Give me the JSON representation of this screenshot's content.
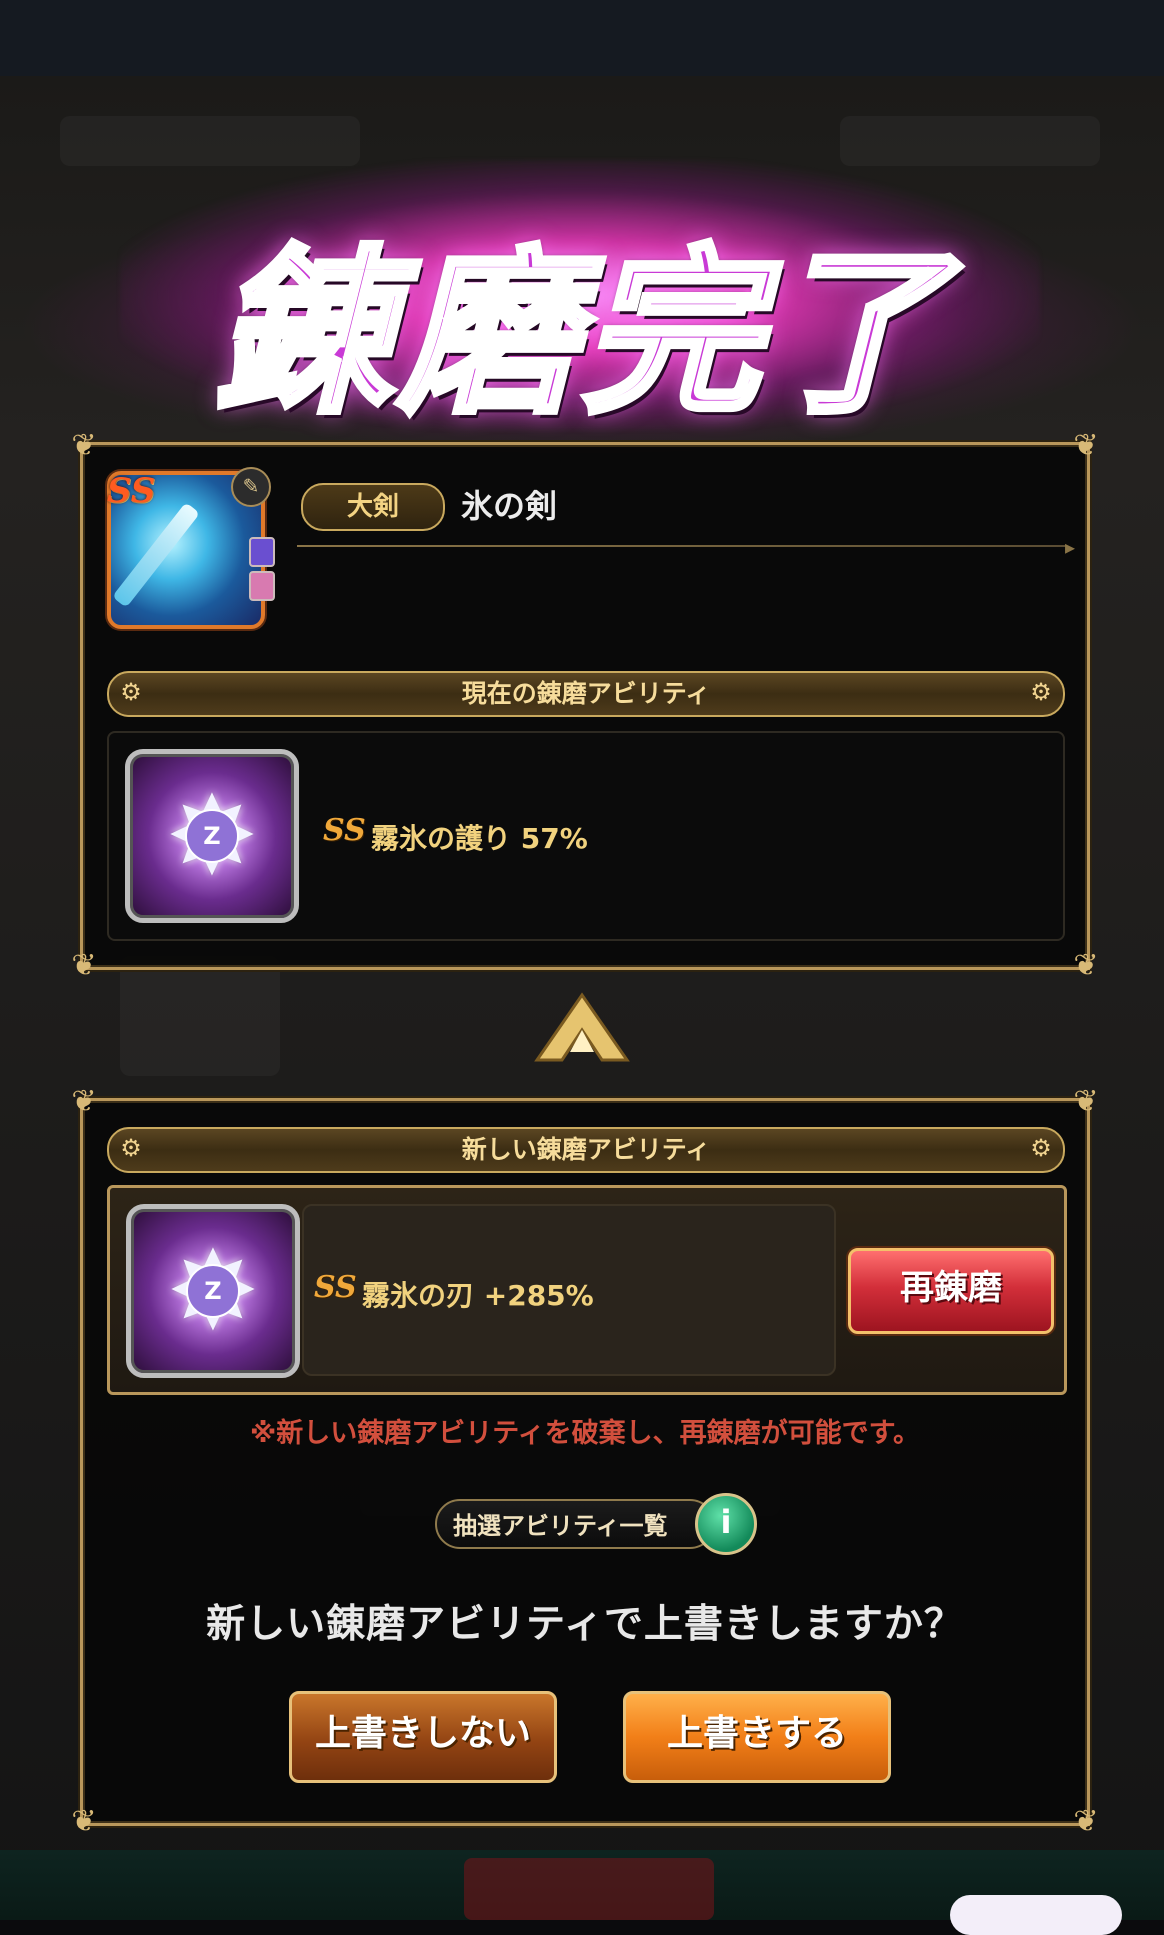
{
  "title": "錬磨完了",
  "weapon": {
    "rarity": "SS",
    "type_label": "大剣",
    "name": "氷の剣",
    "icons": [
      "sword-icon",
      "lock-icon"
    ]
  },
  "current_section": {
    "header": "現在の錬磨アビリティ",
    "ability_mark": "SS",
    "ability_text": "霧氷の護り 57%"
  },
  "new_section": {
    "header": "新しい錬磨アビリティ",
    "ability_mark": "SS",
    "ability_text": "霧氷の刃 +285%",
    "reroll_label": "再錬磨",
    "notice": "※新しい錬磨アビリティを破棄し、再錬磨が可能です。",
    "lottery_list_label": "抽選アビリティ一覧",
    "info_glyph": "i"
  },
  "dialog": {
    "question": "新しい錬磨アビリティで上書きしますか？",
    "no_label": "上書きしない",
    "yes_label": "上書きする"
  },
  "colors": {
    "frame_gold": "#b9975b",
    "title_magenta": "#c93ad6",
    "reroll_red": "#d32f3a",
    "confirm_orange": "#f27f18",
    "notice_red": "#d24f3d"
  }
}
